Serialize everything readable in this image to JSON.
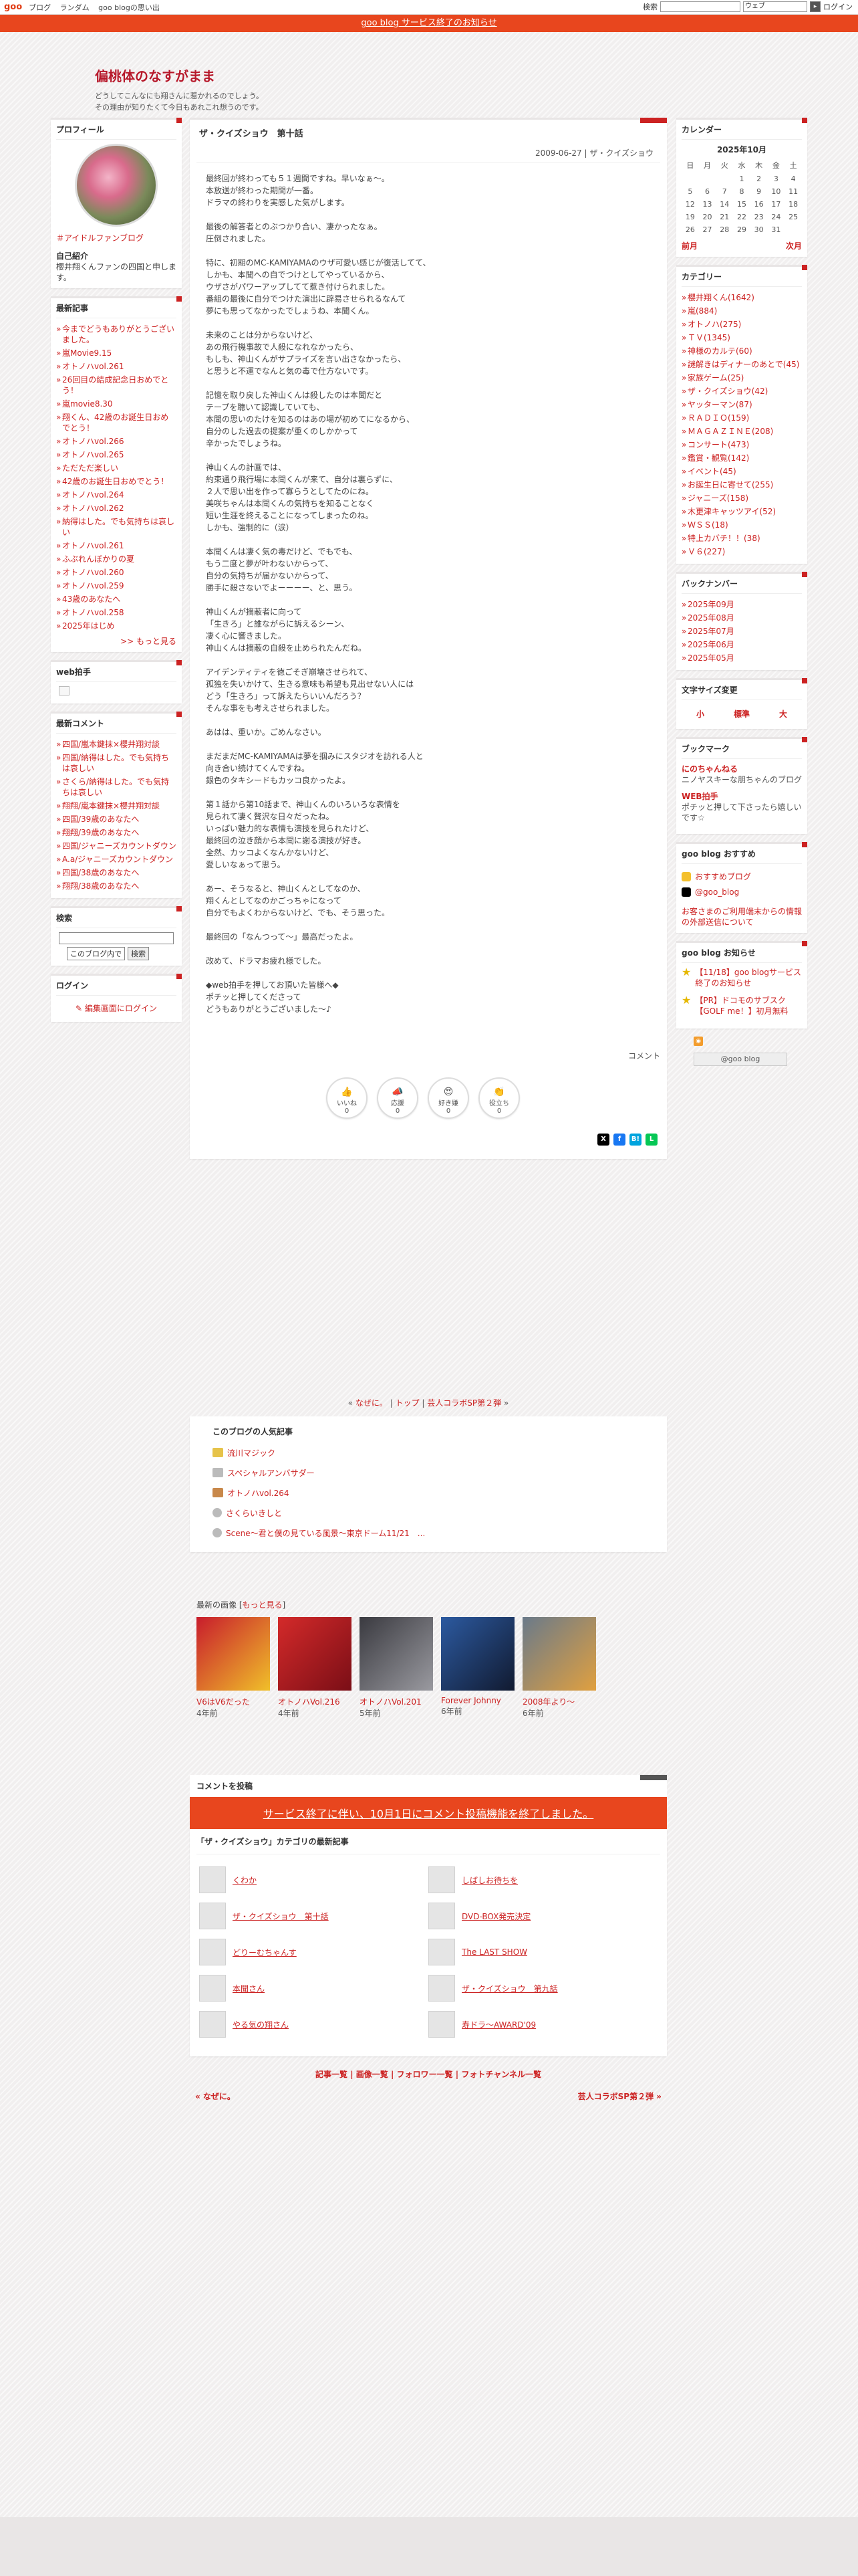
{
  "topbar": {
    "logo": "goo",
    "nav": [
      "ブログ",
      "ランダム",
      "goo blogの思い出"
    ],
    "search_label": "検索",
    "search_select": "ウェブ",
    "login": "ログイン"
  },
  "notice_bar": "goo blog サービス終了のお知らせ",
  "header": {
    "title": "偏桃体のなすがまま",
    "desc_line1": "どうしてこんなにも翔さんに惹かれるのでしょう。",
    "desc_line2": "その理由が知りたくて今日もあれこれ想うのです。"
  },
  "left": {
    "profile": {
      "heading": "プロフィール",
      "link": "＃アイドルファンブログ",
      "sub": "自己紹介",
      "text": "櫻井翔くんファンの四国と申します。"
    },
    "recent": {
      "heading": "最新記事",
      "items": [
        "今までどうもありがとうございました。",
        "嵐Movie9.15",
        "オトノハvol.261",
        "26回目の結成記念日おめでとう！",
        "嵐movie8.30",
        "翔くん、42歳のお誕生日おめでとう！",
        "オトノハvol.266",
        "オトノハvol.265",
        "ただただ楽しい",
        "42歳のお誕生日おめでとう！",
        "オトノハvol.264",
        "オトノハvol.262",
        "納得はした。でも気持ちは哀しい",
        "オトノハvol.261",
        "ふぶれんぼかりの夏",
        "オトノハvol.260",
        "オトノハvol.259",
        "43歳のあなたへ",
        "オトノハvol.258",
        "2025年はじめ"
      ],
      "more": ">> もっと見る"
    },
    "webclap": {
      "heading": "web拍手"
    },
    "comments": {
      "heading": "最新コメント",
      "items": [
        "四国/嵐本鍵抹×櫻井翔対談",
        "四国/納得はした。でも気持ちは哀しい",
        "さくら/納得はした。でも気持ちは哀しい",
        "翔翔/嵐本鍵抹×櫻井翔対談",
        "四国/39歳のあなたへ",
        "翔翔/39歳のあなたへ",
        "四国/ジャニーズカウントダウン",
        "A.a/ジャニーズカウントダウン",
        "四国/38歳のあなたへ",
        "翔翔/38歳のあなたへ"
      ]
    },
    "search": {
      "heading": "検索",
      "scope": "このブログ内で",
      "button": "検索"
    },
    "login": {
      "heading": "ログイン",
      "link": "編集画面にログイン"
    }
  },
  "article": {
    "title": "ザ・クイズショウ　第十話",
    "meta": "2009-06-27 | ザ・クイズショウ",
    "paragraphs": [
      "最終回が終わっても５１週間ですね。早いなぁ〜。\n本放送が終わった期間が一番。\nドラマの終わりを実感した気がします。",
      "最後の解答者とのぶつかり合い、凄かったなぁ。\n圧倒されました。",
      "特に、初期のMC-KAMIYAMAのウザ可愛い感じが復活してて、\nしかも、本聞への自でつけとしてやっているから、\nウザさがパワーアップしてて惹き付けられました。\n番組の最後に自分でつけた演出に辟易させられるなんて\n夢にも思ってなかったでしょうね、本聞くん。",
      "未来のことは分からないけど、\nあの飛行機事故で人殺になれなかったら、\nもしも、神山くんがサプライズを言い出さなかったら、\nと思うと不運でなんと気の毒で仕方ないです。",
      "記憶を取り戻した神山くんは殺したのは本聞だと\nテープを聴いて認識していても、\n本聞の思いのたけを知るのはあの場が初めてになるから、\n自分のした過去の提案が重くのしかかって\n辛かったでしょうね。",
      "神山くんの計画では、\n約束通り飛行場に本聞くんが来て、自分は裏らずに、\n２人で思い出を作って寡らうとしてたのにね。\n美咲ちゃんは本聞くんの気持ちを知ることなく\n短い生涯を終えることになってしまったのね。\nしかも、強制的に（涙）",
      "本聞くんは凄く気の毒だけど、でもでも、\nもう二度と夢が叶わないからって、\n自分の気持ちが届かないからって、\n勝手に殺さないでよーーーー、と、思う。",
      "神山くんが摘蔽者に向って\n「生きろ」と誰ながらに訴えるシーン、\n凄く心に響きました。\n神山くんは摘蔽の自殺を止められたんだね。",
      "アイデンティティを徳ごそぎ崩壊させられて、\n孤独を失いかけて、生きる意味も希望も見出せない人には\nどう「生きろ」って訴えたらいいんだろう？\nそんな事をも考えさせられました。",
      "あはは、重いか。ごめんなさい。",
      "まだまだMC-KAMIYAMAは夢を掴みにスタジオを訪れる人と\n向き合い続けてくんですね。\n銀色のタキシードもカッコ良かったよ。",
      "第１話から第10話まで、神山くんのいろいろな表情を\n見られて凄く贅沢な日々だったね。\nいっぱい魅力的な表情も演技を見られたけど、\n最終回の泣き顔から本聞に謝る演技が好き。\n全然、カッコよくなんかないけど、\n愛しいなぁって思う。",
      "あー、そうなると、神山くんとしてなのか、\n翔くんとしてなのかごっちゃになって\n自分でもよくわからないけど、でも、そう思った。",
      "最終回の「なんつって〜」最高だったよ。",
      "改めて、ドラマお疲れ様でした。",
      "◆web拍手を押してお頂いた皆様へ◆\nポチッと押してくださって\nどうもありがとうございました〜♪"
    ],
    "comment_link": "コメント",
    "reactions": [
      {
        "label": "いいね",
        "count": "0",
        "top": "いいね"
      },
      {
        "label": "応援",
        "count": "0",
        "top": "応援"
      },
      {
        "label": "好き嫌",
        "count": "0",
        "top": "好き嫌"
      },
      {
        "label": "役立ち",
        "count": "0",
        "top": "役立ち"
      }
    ]
  },
  "share": [
    {
      "name": "x",
      "label": "X",
      "color": "#000000"
    },
    {
      "name": "facebook",
      "label": "f",
      "color": "#1877f2"
    },
    {
      "name": "hatena",
      "label": "B!",
      "color": "#00a4de"
    },
    {
      "name": "line",
      "label": "L",
      "color": "#06c755"
    }
  ],
  "nav_links": {
    "prev": "なぜに。",
    "top": "トップ",
    "next": "芸人コラボSP第２弾",
    "prefix": "« ",
    "suffix": " »",
    "sep": " | "
  },
  "popular": {
    "heading": "このブログの人気記事",
    "items": [
      "流川マジック",
      "スペシャルアンバサダー",
      "オトノハvol.264",
      "さくらいきしと",
      "Scene〜君と僕の見ている風景〜東京ドーム11/21　..."
    ]
  },
  "recent_images": {
    "heading": "最新の画像",
    "more": "もっと見る",
    "items": [
      {
        "caption": "V6はV6だった",
        "age": "4年前",
        "color": "#c81c2c"
      },
      {
        "caption": "オトノハVol.216",
        "age": "4年前",
        "color": "#d42a2a"
      },
      {
        "caption": "オトノハVol.201",
        "age": "5年前",
        "color": "#3a3a40"
      },
      {
        "caption": "Forever Johnny",
        "age": "6年前",
        "color": "#2c5aa0"
      },
      {
        "caption": "2008年より〜",
        "age": "6年前",
        "color": "#6a7a8a"
      }
    ]
  },
  "comment_post": {
    "heading": "コメントを投稿",
    "notice": "サービス終了に伴い、10月1日にコメント投稿機能を終了しました。"
  },
  "cat_latest": {
    "heading": "「ザ・クイズショウ」カテゴリの最新記事",
    "items": [
      "くわか",
      "しばしお待ちを",
      "ザ・クイズショウ　第十話",
      "DVD-BOX発売決定",
      "どりーむちゃんす",
      "The LAST SHOW",
      "本聞さん",
      "ザ・クイズショウ　第九話",
      "やる気の翔さん",
      "寿ドラ〜AWARD'09"
    ]
  },
  "footer_links": [
    "記事一覧",
    "画像一覧",
    "フォロワー一覧",
    "フォトチャンネル一覧"
  ],
  "footer_nav": {
    "prev": "« なぜに。",
    "next": "芸人コラボSP第２弾 »"
  },
  "right": {
    "calendar": {
      "heading": "カレンダー",
      "month": "2025年10月",
      "days": [
        "日",
        "月",
        "火",
        "水",
        "木",
        "金",
        "土"
      ],
      "weeks": [
        [
          "",
          "",
          "",
          "1",
          "2",
          "3",
          "4"
        ],
        [
          "5",
          "6",
          "7",
          "8",
          "9",
          "10",
          "11"
        ],
        [
          "12",
          "13",
          "14",
          "15",
          "16",
          "17",
          "18"
        ],
        [
          "19",
          "20",
          "21",
          "22",
          "23",
          "24",
          "25"
        ],
        [
          "26",
          "27",
          "28",
          "29",
          "30",
          "31",
          ""
        ]
      ],
      "prev": "前月",
      "next": "次月"
    },
    "categories": {
      "heading": "カテゴリー",
      "items": [
        "櫻井翔くん(1642)",
        "嵐(884)",
        "オトノハ(275)",
        "ＴＶ(1345)",
        "神様のカルテ(60)",
        "謎解きはディナーのあとで(45)",
        "家族ゲーム(25)",
        "ザ・クイズショウ(42)",
        "ヤッターマン(87)",
        "ＲＡＤＩＯ(159)",
        "ＭＡＧＡＺＩＮＥ(208)",
        "コンサート(473)",
        "鑑賞・観覧(142)",
        "イベント(45)",
        "お誕生日に寄せて(255)",
        "ジャニーズ(158)",
        "木更津キャッツアイ(52)",
        "ＷＳＳ(18)",
        "特上カバチ！！(38)",
        "Ｖ６(227)"
      ]
    },
    "backnumber": {
      "heading": "バックナンバー",
      "items": [
        "2025年09月",
        "2025年08月",
        "2025年07月",
        "2025年06月",
        "2025年05月"
      ]
    },
    "fontsize": {
      "heading": "文字サイズ変更",
      "small": "小",
      "normal": "標準",
      "large": "大"
    },
    "bookmark": {
      "heading": "ブックマーク",
      "items": [
        {
          "title": "にのちゃんねる",
          "desc": "ニノヤスキーな朋ちゃんのブログ"
        },
        {
          "title": "WEB拍手",
          "desc": "ポチッと押して下さったら嬉しいです☆"
        }
      ]
    },
    "goo_recommend": {
      "heading": "goo blog おすすめ",
      "items": [
        "おすすめブログ",
        "@goo_blog"
      ],
      "warning": "お客さまのご利用端末からの情報の外部送信について"
    },
    "goo_notice": {
      "heading": "goo blog お知らせ",
      "items": [
        "【11/18】goo blogサービス終了のお知らせ",
        "【PR】ドコモのサブスク【GOLF me！】初月無料"
      ]
    },
    "badge": "@goo blog"
  },
  "colors": {
    "accent": "#c22222",
    "notice": "#e8461e",
    "title": "#b7182a"
  }
}
